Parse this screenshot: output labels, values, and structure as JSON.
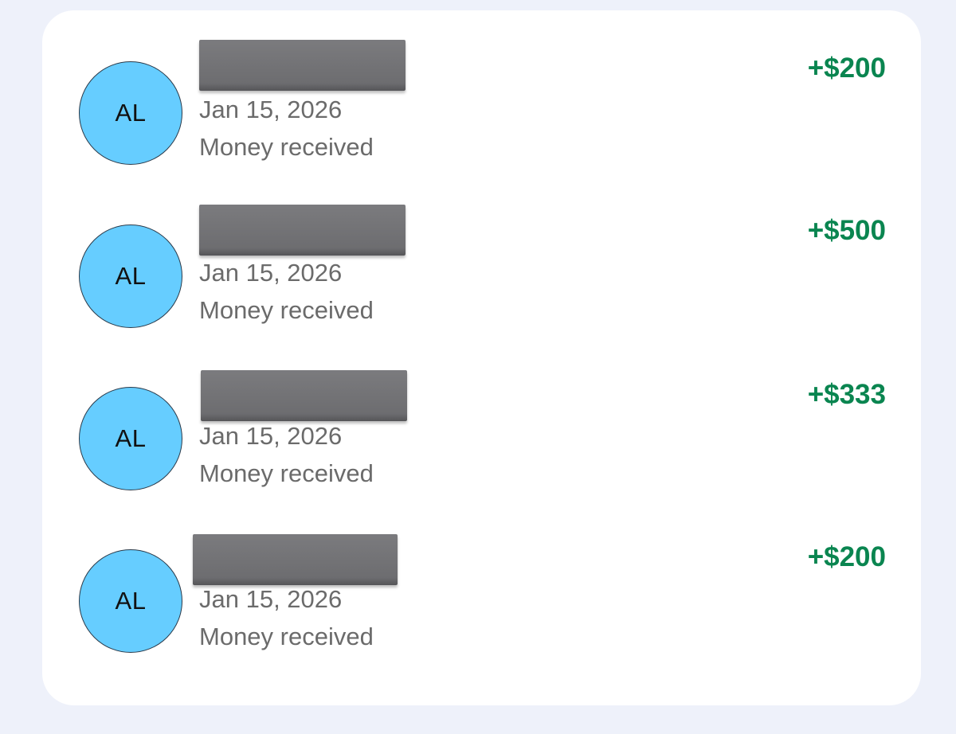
{
  "transactions": [
    {
      "initials": "AL",
      "date": "Jan 15, 2026",
      "description": "Money received",
      "amount": "+$200"
    },
    {
      "initials": "AL",
      "date": "Jan 15, 2026",
      "description": "Money received",
      "amount": "+$500"
    },
    {
      "initials": "AL",
      "date": "Jan 15, 2026",
      "description": "Money received",
      "amount": "+$333"
    },
    {
      "initials": "AL",
      "date": "Jan 15, 2026",
      "description": "Money received",
      "amount": "+$200"
    }
  ],
  "colors": {
    "page_background": "#eef1fa",
    "card_background": "#ffffff",
    "avatar": "#66cdff",
    "amount_positive": "#0a8550",
    "secondary_text": "#6b6b6b",
    "redaction": "#707073"
  }
}
